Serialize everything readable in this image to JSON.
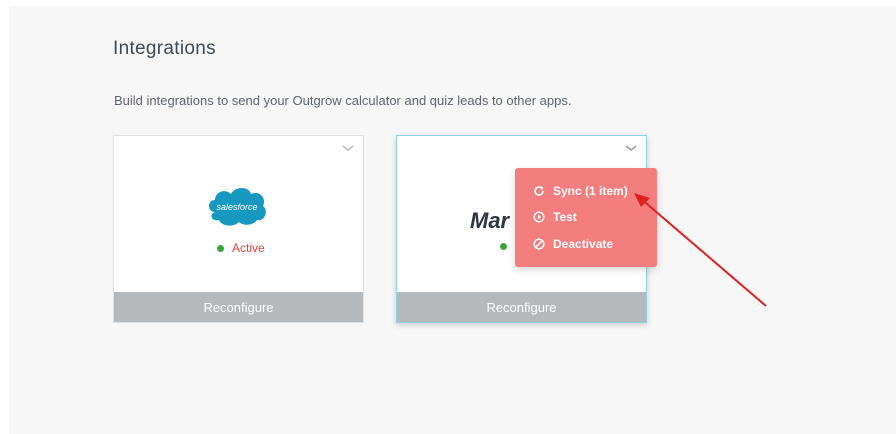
{
  "page": {
    "title": "Integrations",
    "subtitle": "Build integrations to send your Outgrow calculator and quiz leads to other apps."
  },
  "cards": [
    {
      "logo_text": "salesforce",
      "status": "Active",
      "button": "Reconfigure"
    },
    {
      "logo_text": "Mar",
      "button": "Reconfigure"
    }
  ],
  "menu": {
    "items": [
      {
        "label": "Sync (1 item)",
        "icon": "sync-icon"
      },
      {
        "label": "Test",
        "icon": "play-circle-icon"
      },
      {
        "label": "Deactivate",
        "icon": "ban-icon"
      }
    ]
  },
  "colors": {
    "menu_bg": "#f47e7e",
    "button_bg": "#b6b9bc",
    "status_active": "#e0463c",
    "status_dot": "#3fa33c",
    "salesforce_blue": "#1798c1",
    "annotation_arrow": "#e02020"
  }
}
